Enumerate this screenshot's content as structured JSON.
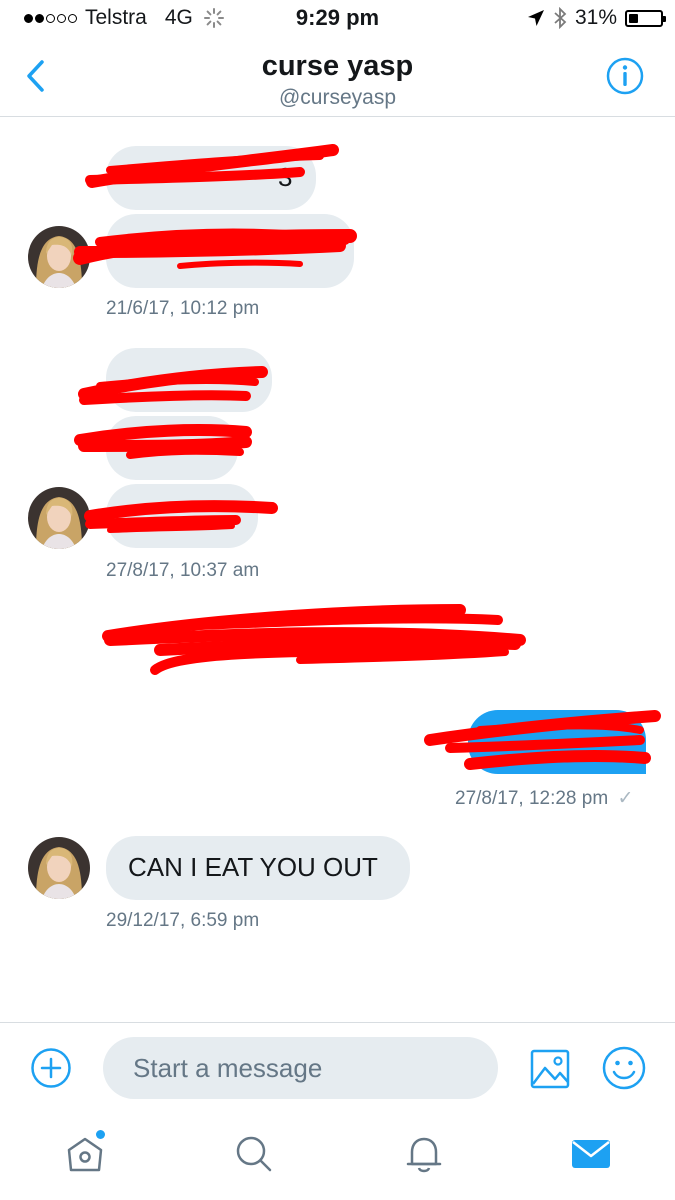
{
  "status_bar": {
    "carrier": "Telstra",
    "network": "4G",
    "time": "9:29 pm",
    "battery": "31%",
    "battery_level": 0.31
  },
  "header": {
    "title": "curse yasp",
    "handle": "@curseyasp"
  },
  "messages": {
    "group1_timestamp": "21/6/17, 10:12 pm",
    "group1_visible_fragment": "3",
    "group2_timestamp": "27/8/17, 10:37 am",
    "sent_timestamp": "27/8/17, 12:28 pm",
    "last_message": "CAN I EAT YOU OUT",
    "last_timestamp": "29/12/17, 6:59 pm"
  },
  "compose": {
    "placeholder": "Start a message"
  },
  "colors": {
    "accent": "#1da1f2",
    "bubble_received": "#e6ecf0",
    "redaction": "#ff0000",
    "secondary_text": "#657786"
  }
}
